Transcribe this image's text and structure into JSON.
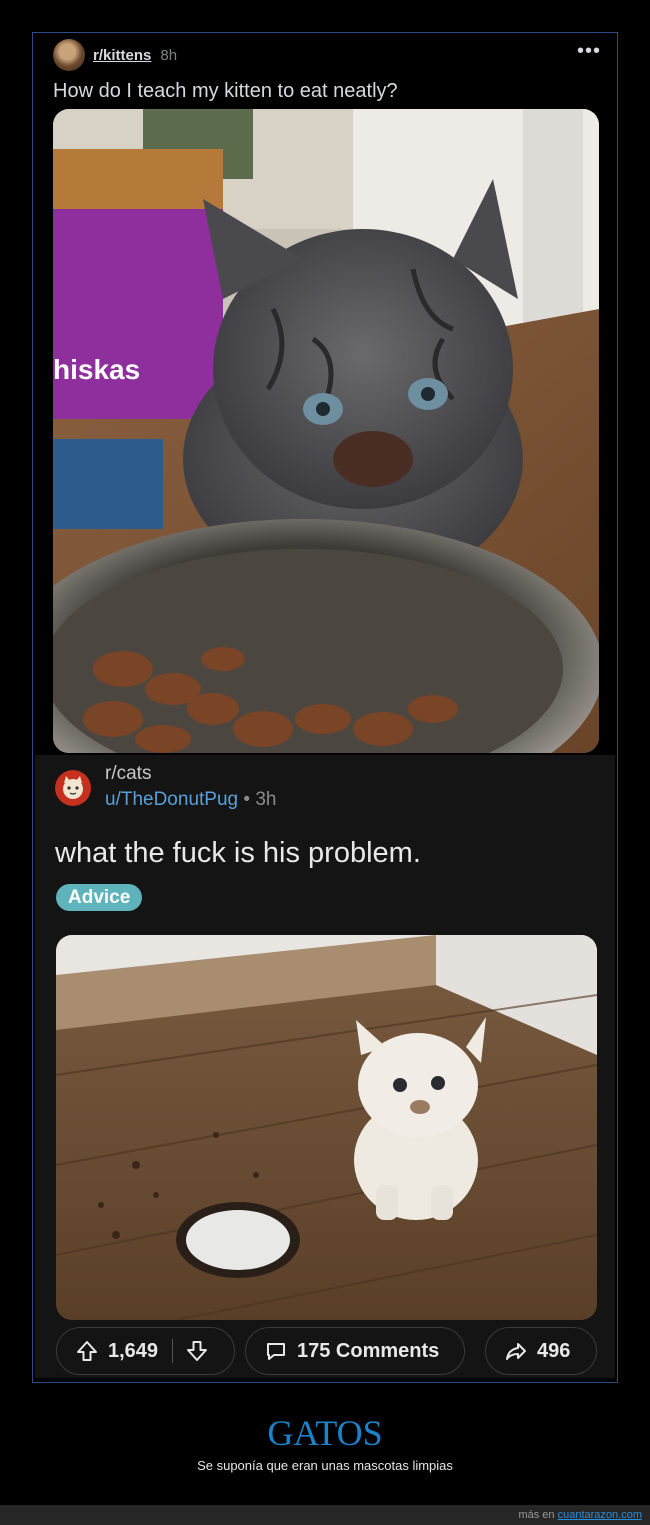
{
  "post1": {
    "subreddit": "r/kittens",
    "time": "8h",
    "more": "•••",
    "title": "How do I teach my kitten to eat neatly?",
    "image_text": "hiskas"
  },
  "post2": {
    "subreddit": "r/cats",
    "user": "u/TheDonutPug",
    "separator": "•",
    "time": "3h",
    "title": "what the fuck is his problem.",
    "flair": "Advice",
    "upvotes": "1,649",
    "comments": "175 Comments",
    "shares": "496"
  },
  "caption": {
    "title": "GATOS",
    "subtitle": "Se suponía que eran unas mascotas limpias"
  },
  "footer": {
    "prefix": "más en",
    "site": "cuantarazon.com"
  },
  "colors": {
    "frame_border": "#2f4a8a",
    "flair": "#5fb3bd",
    "caption": "#1a83c9",
    "username": "#5aa0d8"
  }
}
